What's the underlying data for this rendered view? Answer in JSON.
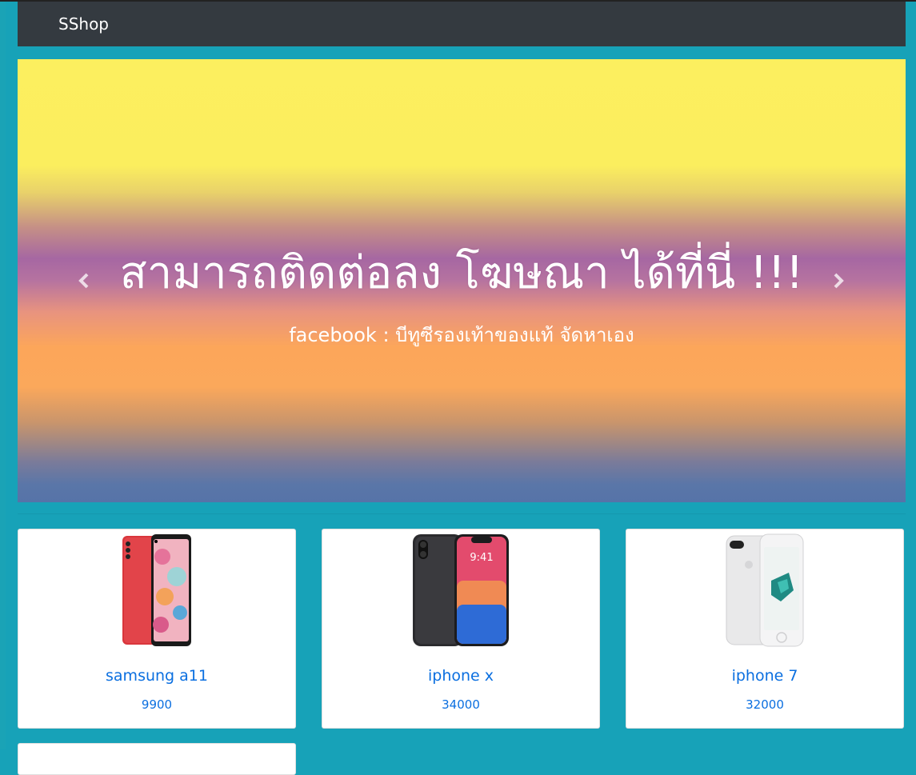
{
  "navbar": {
    "brand": "SShop"
  },
  "carousel": {
    "title": "สามารถติดต่อลง โฆษณา ได้ที่นี่ !!!",
    "subtitle": "facebook : บีทูซีรองเท้าของแท้ จัดหาเอง",
    "prev_icon": "chevron-left-icon",
    "next_icon": "chevron-right-icon"
  },
  "products": [
    {
      "name": "samsung a11",
      "price": "9900",
      "image": "red-samsung-phone"
    },
    {
      "name": "iphone x",
      "price": "34000",
      "image": "space-gray-iphone-x"
    },
    {
      "name": "iphone 7",
      "price": "32000",
      "image": "silver-iphone-7-plus"
    }
  ],
  "colors": {
    "page_bg": "#17a2b8",
    "navbar_bg": "#343a40",
    "link": "#0b6fe0"
  }
}
